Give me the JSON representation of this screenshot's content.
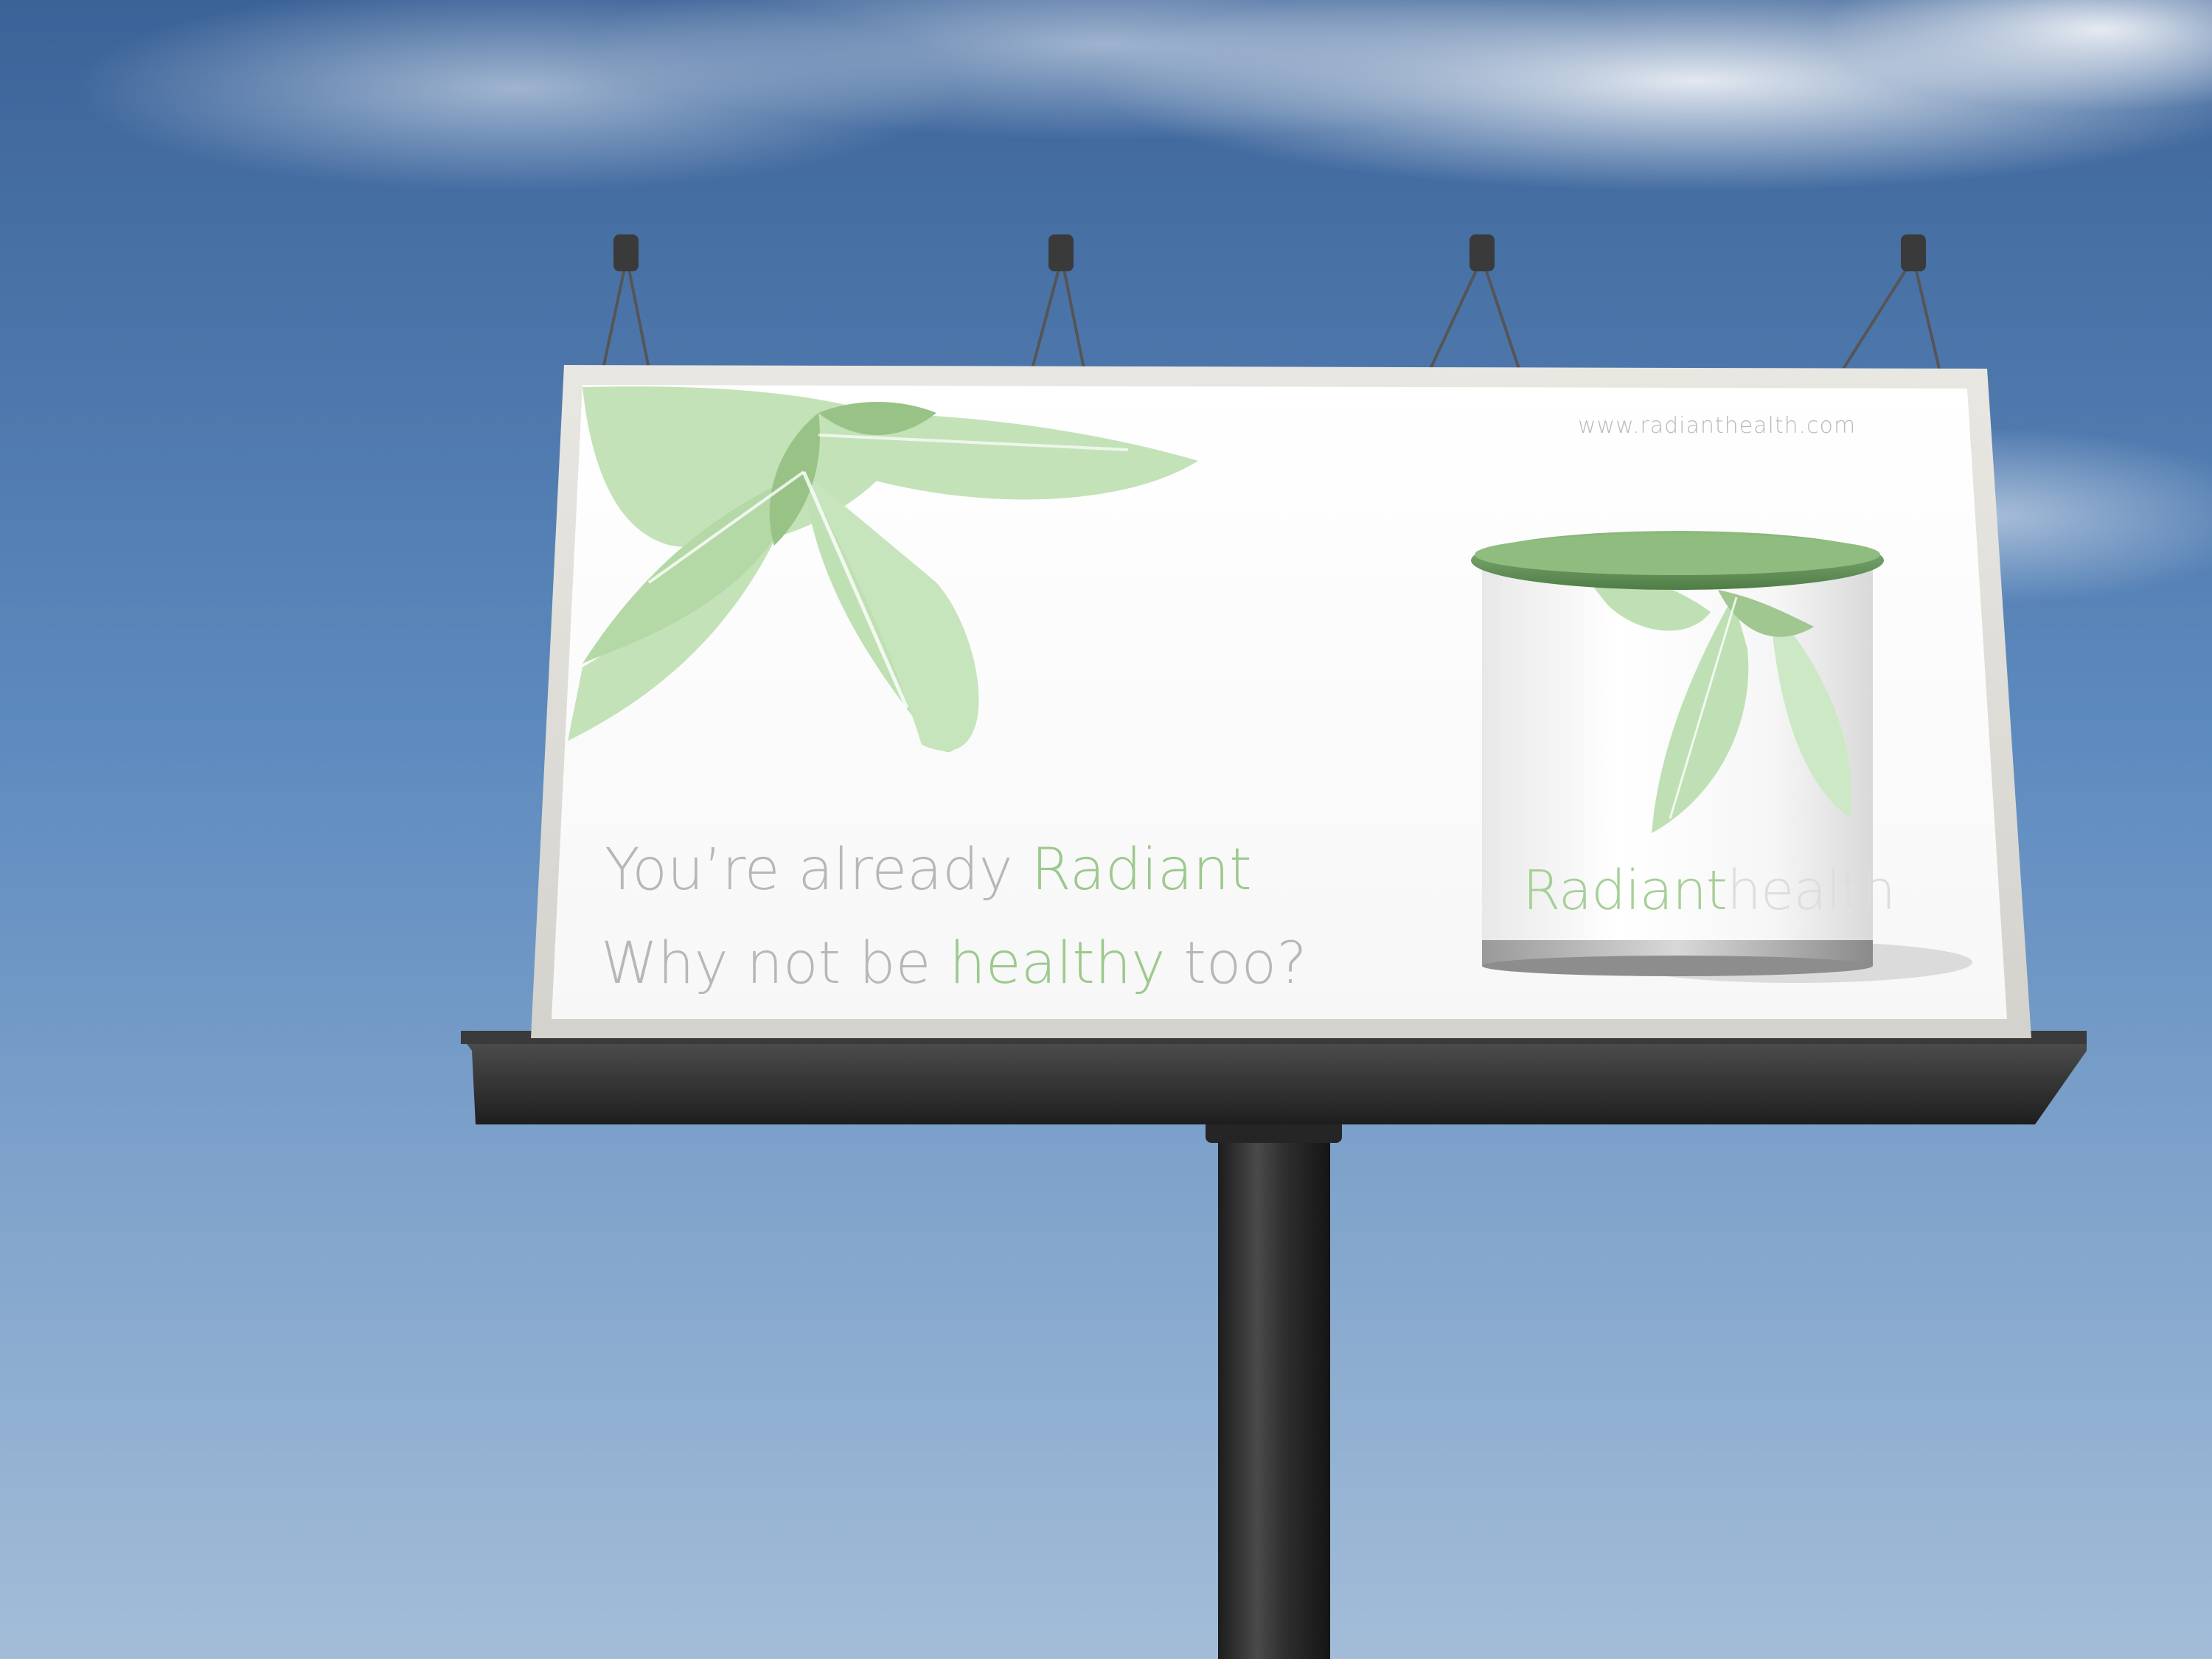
{
  "billboard": {
    "url": "www.radianthealth.com",
    "headline": {
      "line1_prefix": "You’re already ",
      "line1_highlight": "Radiant",
      "line2_prefix": "Why not be ",
      "line2_highlight": "healthy",
      "line2_suffix": " too?"
    },
    "product": {
      "brand_part1": "Radiant",
      "brand_part2": "health"
    }
  },
  "colors": {
    "sky_top": "#3f669b",
    "sky_bottom": "#9fbad6",
    "text_gray": "#b7b7b7",
    "text_green": "#9cc98d",
    "leaf_light": "#bfe0b4",
    "leaf_dark": "#9fc78f",
    "lid_green": "#6f9e63",
    "structure": "#2b2b2b"
  }
}
